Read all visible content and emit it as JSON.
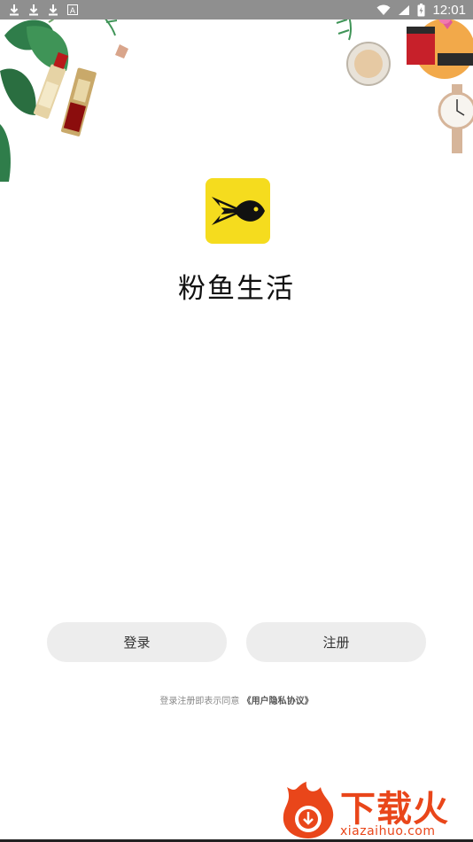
{
  "status_bar": {
    "time": "12:01",
    "left_icons": [
      "download-icon",
      "download-icon",
      "download-icon",
      "a-icon"
    ],
    "right_icons": [
      "wifi-icon",
      "signal-icon",
      "battery-icon"
    ]
  },
  "app": {
    "name": "粉鱼生活",
    "logo_color": "#f5dc1e"
  },
  "buttons": {
    "login_label": "登录",
    "register_label": "注册"
  },
  "agreement": {
    "prefix": "登录注册即表示同意",
    "link": "《用户隐私协议》"
  },
  "watermark": {
    "brand": "下载火",
    "url": "xiazaihuo.com",
    "color": "#e9461a"
  }
}
